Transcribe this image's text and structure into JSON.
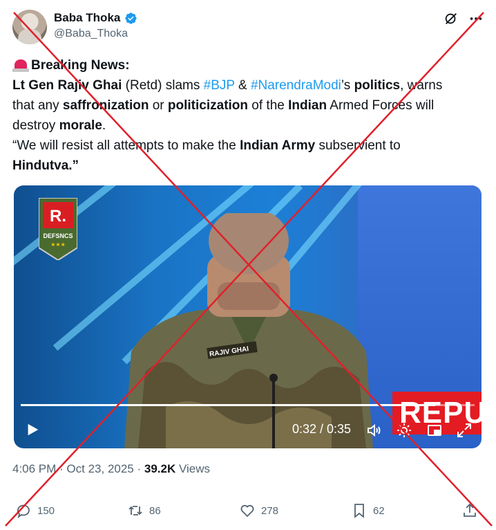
{
  "author": {
    "display_name": "Baba Thoka",
    "handle": "@Baba_Thoka",
    "verified": true
  },
  "header_icons": [
    "grok-icon",
    "more-icon"
  ],
  "tweet": {
    "line1": {
      "heading": "Breaking News:"
    },
    "line2": {
      "p1": "Lt Gen Rajiv Ghai",
      "p2": " (Retd) slams ",
      "tag1": "#BJP",
      "p3": " & ",
      "tag2": "#NarendraModi",
      "p4": "’s ",
      "p5": "politics",
      "p6": ", warns"
    },
    "line3": {
      "p1": "that any ",
      "p2": "saffronization",
      "p3": " or ",
      "p4": "politicization",
      "p5": " of the ",
      "p6": "Indian",
      "p7": " Armed Forces will"
    },
    "line4": {
      "p1": "destroy ",
      "p2": "morale",
      "p3": "."
    },
    "line5": {
      "p1": "“We will resist all attempts to make the ",
      "p2": "Indian Army",
      "p3": " subservient to"
    },
    "line6": {
      "p1": "Hindutva.”"
    }
  },
  "video": {
    "logo_letter": "R.",
    "logo_text": "DEFSNCS",
    "nameplate": "RAJIV GHAI",
    "badge_text": "REPU",
    "time": "0:32 / 0:35",
    "progress": 0.914
  },
  "meta": {
    "timestamp": "4:06 PM · Oct 23, 2025",
    "separator": " · ",
    "views_count": "39.2K",
    "views_label": " Views"
  },
  "actions": {
    "replies": "150",
    "reposts": "86",
    "likes": "278",
    "bookmarks": "62"
  },
  "colors": {
    "link": "#1d9bf0",
    "verified": "#1d9bf0",
    "cross": "#e0202a",
    "muted": "#536471"
  }
}
